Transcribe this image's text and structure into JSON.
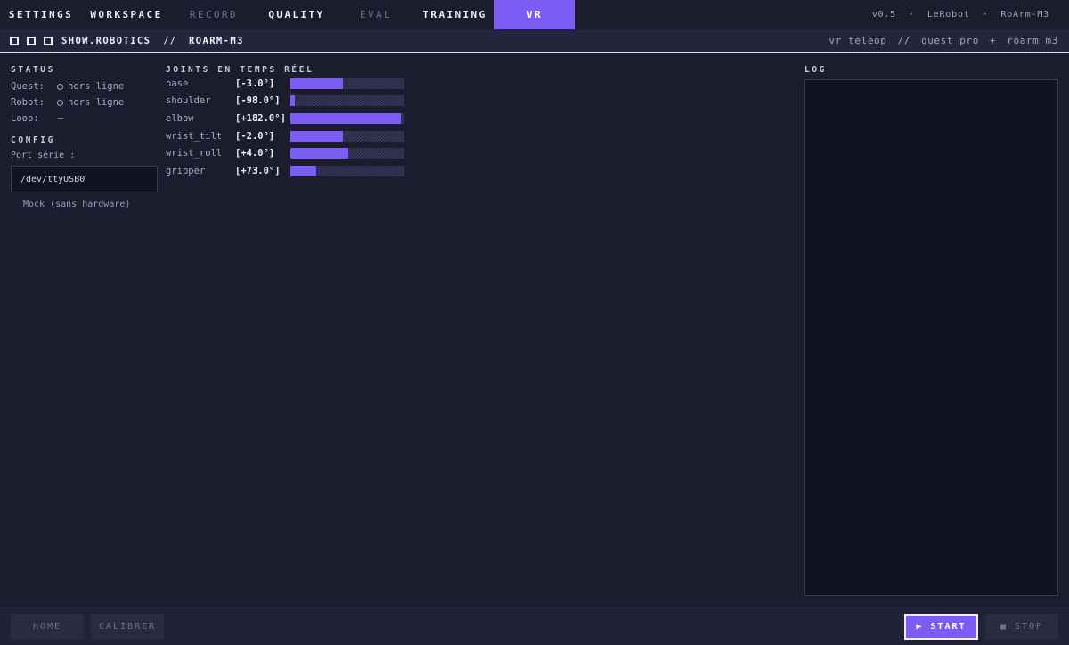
{
  "nav": {
    "tabs": [
      {
        "label": "SETTINGS",
        "state": "normal"
      },
      {
        "label": "WORKSPACE",
        "state": "normal"
      },
      {
        "label": "RECORD",
        "state": "dim"
      },
      {
        "label": "QUALITY",
        "state": "normal"
      },
      {
        "label": "EVAL",
        "state": "dim"
      },
      {
        "label": "TRAINING",
        "state": "normal"
      },
      {
        "label": "VR",
        "state": "active"
      }
    ],
    "version": "v0.5",
    "framework": "LeRobot",
    "device": "RoArm-M3",
    "separator": "·"
  },
  "subheader": {
    "brand": "SHOW.ROBOTICS",
    "sep": "//",
    "robot": "ROARM-M3",
    "mode": "vr teleop",
    "mode_sep": "//",
    "headset": "quest pro",
    "plus": "+",
    "arm": "roarm m3"
  },
  "status": {
    "title": "STATUS",
    "quest_label": "Quest:",
    "quest_value": "hors ligne",
    "robot_label": "Robot:",
    "robot_value": "hors ligne",
    "loop_label": "Loop:",
    "loop_value": "—"
  },
  "config": {
    "title": "CONFIG",
    "port_label": "Port série :",
    "port_value": "/dev/ttyUSB0",
    "mock_label": "Mock (sans hardware)"
  },
  "joints": {
    "title": "JOINTS EN TEMPS RÉEL",
    "items": [
      {
        "name": "base",
        "value": "[-3.0°]",
        "level": 0.46
      },
      {
        "name": "shoulder",
        "value": "[-98.0°]",
        "level": 0.04
      },
      {
        "name": "elbow",
        "value": "[+182.0°]",
        "level": 0.97
      },
      {
        "name": "wrist_tilt",
        "value": "[-2.0°]",
        "level": 0.46
      },
      {
        "name": "wrist_roll",
        "value": "[+4.0°]",
        "level": 0.51
      },
      {
        "name": "gripper",
        "value": "[+73.0°]",
        "level": 0.23
      }
    ]
  },
  "log": {
    "title": "LOG"
  },
  "footer": {
    "home": "HOME",
    "calibrer": "CALIBRER",
    "start": "▶ START",
    "stop": "■ STOP"
  },
  "colors": {
    "accent": "#7b5cf5",
    "bg": "#1b1c2e",
    "panel": "#121320"
  }
}
